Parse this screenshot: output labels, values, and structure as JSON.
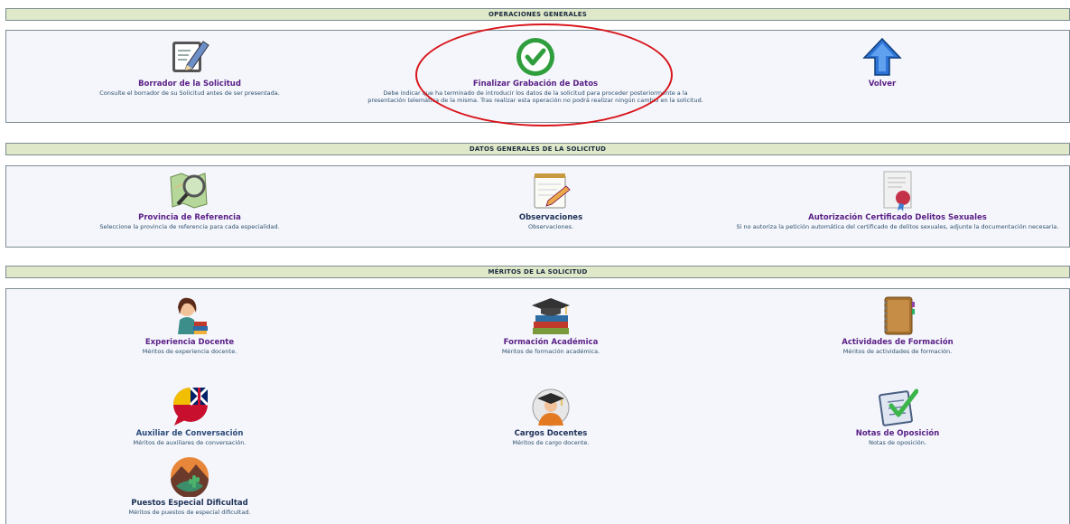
{
  "sections": {
    "operaciones": {
      "title": "OPERACIONES GENERALES",
      "items": [
        {
          "label": "Borrador de la Solicitud",
          "desc": "Consulte el borrador de su Solicitud antes de ser presentada.",
          "icon": "edit-document-icon"
        },
        {
          "label": "Finalizar Grabación de Datos",
          "desc": "Debe indicar que ha terminado de introducir los datos de la solicitud para proceder posteriormente a la presentación telemática de la misma. Tras realizar esta operación no podrá realizar ningún cambio en la solicitud.",
          "icon": "checkmark-circle-icon"
        },
        {
          "label": "Volver",
          "desc": "",
          "icon": "up-arrow-icon"
        }
      ]
    },
    "datos": {
      "title": "DATOS GENERALES DE LA SOLICITUD",
      "items": [
        {
          "label": "Provincia de Referencia",
          "desc": "Seleccione la provincia de referencia para cada especialidad.",
          "icon": "map-magnifier-icon"
        },
        {
          "label": "Observaciones",
          "desc": "Observaciones.",
          "icon": "notepad-pencil-icon"
        },
        {
          "label": "Autorización Certificado Delitos Sexuales",
          "desc": "Si no autoriza la petición automática del certificado de delitos sexuales, adjunte la documentación necesaria.",
          "icon": "certificate-seal-icon"
        }
      ]
    },
    "meritos": {
      "title": "MÉRITOS DE LA SOLICITUD",
      "items": [
        {
          "label": "Experiencia Docente",
          "desc": "Méritos de experiencia docente.",
          "icon": "teacher-icon"
        },
        {
          "label": "Formación Académica",
          "desc": "Méritos de formación académica.",
          "icon": "books-cap-icon"
        },
        {
          "label": "Actividades de Formación",
          "desc": "Méritos de actividades de formación.",
          "icon": "notebook-icon"
        },
        {
          "label": "Auxiliar de Conversación",
          "desc": "Méritos de auxiliares de conversación.",
          "icon": "language-flags-icon"
        },
        {
          "label": "Cargos Docentes",
          "desc": "Méritos de cargo docente.",
          "icon": "graduate-icon"
        },
        {
          "label": "Notas de Oposición",
          "desc": "Notas de oposición.",
          "icon": "checklist-icon"
        },
        {
          "label": "Puestos Especial Dificultad",
          "desc": "Méritos de puestos de especial dificultad.",
          "icon": "mountain-cactus-icon"
        }
      ]
    }
  },
  "colors": {
    "header_bg": "#dfe8c8",
    "panel_bg": "#f4f6fb",
    "link_purple": "#5a1e86",
    "highlight_red": "#d8141a"
  }
}
